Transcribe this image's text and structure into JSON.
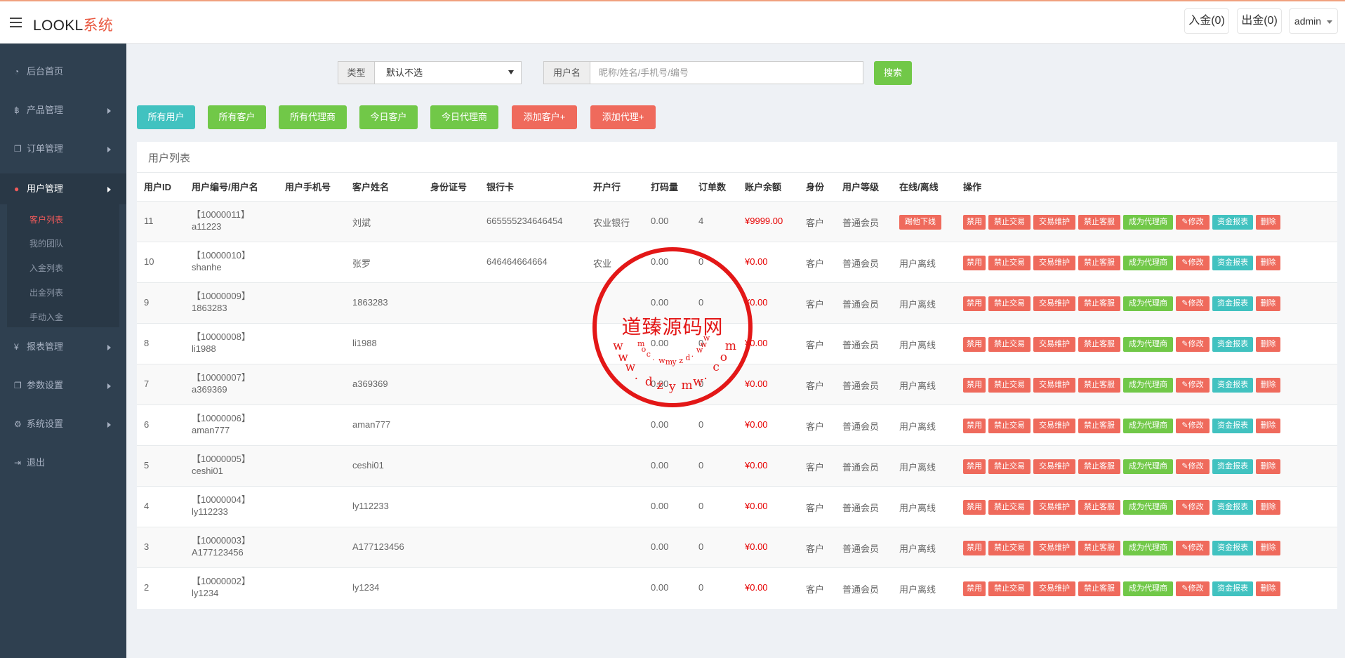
{
  "header": {
    "brand_main": "LOOKL",
    "brand_accent": "系统",
    "deposit": "入金(0)",
    "withdraw": "出金(0)",
    "user": "admin"
  },
  "sidebar": {
    "items": [
      {
        "label": "后台首页",
        "icon": "dashboard-icon"
      },
      {
        "label": "产品管理",
        "icon": "bitcoin-icon"
      },
      {
        "label": "订单管理",
        "icon": "copy-icon"
      },
      {
        "label": "用户管理",
        "icon": "user-icon"
      },
      {
        "label": "报表管理",
        "icon": "yen-icon"
      },
      {
        "label": "参数设置",
        "icon": "copy-icon"
      },
      {
        "label": "系统设置",
        "icon": "gears-icon"
      },
      {
        "label": "退出",
        "icon": "sign-out-icon"
      }
    ],
    "subitems": [
      "客户列表",
      "我的团队",
      "入金列表",
      "出金列表",
      "手动入金"
    ]
  },
  "search": {
    "type_label": "类型",
    "type_value": "默认不选",
    "user_label": "用户名",
    "user_placeholder": "昵称/姓名/手机号/编号",
    "search_button": "搜索"
  },
  "filters": [
    "所有用户",
    "所有客户",
    "所有代理商",
    "今日客户",
    "今日代理商",
    "添加客户+",
    "添加代理+"
  ],
  "panel_title": "用户列表",
  "columns": [
    "用户ID",
    "用户编号/用户名",
    "用户手机号",
    "客户姓名",
    "身份证号",
    "银行卡",
    "开户行",
    "打码量",
    "订单数",
    "账户余额",
    "身份",
    "用户等级",
    "在线/离线",
    "操作"
  ],
  "rows": [
    {
      "id": "11",
      "code": "【10000011】",
      "username": "a11223",
      "phone": "",
      "name": "刘斌",
      "idcard": "",
      "bank_card": "665555234646454",
      "bank": "农业银行",
      "volume": "0.00",
      "orders": "4",
      "balance": "¥9999.00",
      "role": "客户",
      "level": "普通会员",
      "status": "踢他下线"
    },
    {
      "id": "10",
      "code": "【10000010】",
      "username": "shanhe",
      "phone": "",
      "name": "张罗",
      "idcard": "",
      "bank_card": "646464664664",
      "bank": "农业",
      "volume": "0.00",
      "orders": "0",
      "balance": "¥0.00",
      "role": "客户",
      "level": "普通会员",
      "status": "用户离线"
    },
    {
      "id": "9",
      "code": "【10000009】",
      "username": "1863283",
      "phone": "",
      "name": "1863283",
      "idcard": "",
      "bank_card": "",
      "bank": "",
      "volume": "0.00",
      "orders": "0",
      "balance": "¥0.00",
      "role": "客户",
      "level": "普通会员",
      "status": "用户离线"
    },
    {
      "id": "8",
      "code": "【10000008】",
      "username": "li1988",
      "phone": "",
      "name": "li1988",
      "idcard": "",
      "bank_card": "",
      "bank": "",
      "volume": "0.00",
      "orders": "0",
      "balance": "¥0.00",
      "role": "客户",
      "level": "普通会员",
      "status": "用户离线"
    },
    {
      "id": "7",
      "code": "【10000007】",
      "username": "a369369",
      "phone": "",
      "name": "a369369",
      "idcard": "",
      "bank_card": "",
      "bank": "",
      "volume": "0.00",
      "orders": "0",
      "balance": "¥0.00",
      "role": "客户",
      "level": "普通会员",
      "status": "用户离线"
    },
    {
      "id": "6",
      "code": "【10000006】",
      "username": "aman777",
      "phone": "",
      "name": "aman777",
      "idcard": "",
      "bank_card": "",
      "bank": "",
      "volume": "0.00",
      "orders": "0",
      "balance": "¥0.00",
      "role": "客户",
      "level": "普通会员",
      "status": "用户离线"
    },
    {
      "id": "5",
      "code": "【10000005】",
      "username": "ceshi01",
      "phone": "",
      "name": "ceshi01",
      "idcard": "",
      "bank_card": "",
      "bank": "",
      "volume": "0.00",
      "orders": "0",
      "balance": "¥0.00",
      "role": "客户",
      "level": "普通会员",
      "status": "用户离线"
    },
    {
      "id": "4",
      "code": "【10000004】",
      "username": "ly112233",
      "phone": "",
      "name": "ly112233",
      "idcard": "",
      "bank_card": "",
      "bank": "",
      "volume": "0.00",
      "orders": "0",
      "balance": "¥0.00",
      "role": "客户",
      "level": "普通会员",
      "status": "用户离线"
    },
    {
      "id": "3",
      "code": "【10000003】",
      "username": "A177123456",
      "phone": "",
      "name": "A177123456",
      "idcard": "",
      "bank_card": "",
      "bank": "",
      "volume": "0.00",
      "orders": "0",
      "balance": "¥0.00",
      "role": "客户",
      "level": "普通会员",
      "status": "用户离线"
    },
    {
      "id": "2",
      "code": "【10000002】",
      "username": "ly1234",
      "phone": "",
      "name": "ly1234",
      "idcard": "",
      "bank_card": "",
      "bank": "",
      "volume": "0.00",
      "orders": "0",
      "balance": "¥0.00",
      "role": "客户",
      "level": "普通会员",
      "status": "用户离线"
    }
  ],
  "actions": [
    "禁用",
    "禁止交易",
    "交易维护",
    "禁止客服",
    "成为代理商",
    "✎修改",
    "资金报表",
    "删除"
  ],
  "watermark": {
    "main": "道臻源码网",
    "top_letters": [
      "w",
      "w",
      "w",
      ".",
      "d",
      "z",
      "y",
      "m",
      "w",
      ".",
      "c",
      "o",
      "m"
    ],
    "bottom_letters": [
      "w",
      "w",
      "w",
      ".",
      "d",
      "z",
      "y",
      "m",
      "w",
      ".",
      "c",
      "o",
      "m"
    ]
  },
  "colors": {
    "sidebar": "#2f4050",
    "green": "#71c848",
    "teal": "#41c2c0",
    "red": "#ef6a5c",
    "accent": "#e9573f",
    "seal": "#e31717"
  }
}
